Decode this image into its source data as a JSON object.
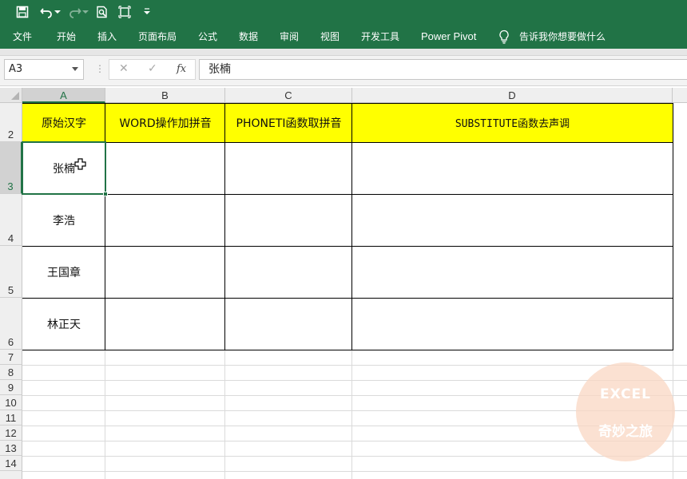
{
  "qat": {
    "save_icon": "save-icon",
    "undo_icon": "undo-icon",
    "redo_icon": "redo-icon",
    "print_preview_icon": "print-preview-icon",
    "touch_mode_icon": "touch-mode-icon",
    "customize_icon": "customize-qat-icon"
  },
  "ribbon": {
    "tabs": [
      "文件",
      "开始",
      "插入",
      "页面布局",
      "公式",
      "数据",
      "审阅",
      "视图",
      "开发工具",
      "Power Pivot"
    ],
    "tell_me": "告诉我你想要做什么"
  },
  "formula_bar": {
    "name_box": "A3",
    "cancel_glyph": "✕",
    "enter_glyph": "✓",
    "fx_label": "fx",
    "value": "张楠"
  },
  "grid": {
    "columns": [
      "A",
      "B",
      "C",
      "D"
    ],
    "rows": [
      "2",
      "3",
      "4",
      "5",
      "6",
      "7",
      "8",
      "9",
      "10",
      "11",
      "12",
      "13",
      "14"
    ],
    "selected_cell": "A3",
    "header_fill": "#ffff00",
    "headers": [
      "原始汉字",
      "WORD操作加拼音",
      "PHONETI函数取拼音",
      "SUBSTITUTE函数去声调"
    ],
    "names": [
      "张楠",
      "李浩",
      "王国章",
      "林正天"
    ]
  },
  "watermark": {
    "line1": "EXCEL",
    "line2": "奇妙之旅"
  },
  "colors": {
    "accent": "#217346",
    "header_fill": "#ffff00"
  }
}
